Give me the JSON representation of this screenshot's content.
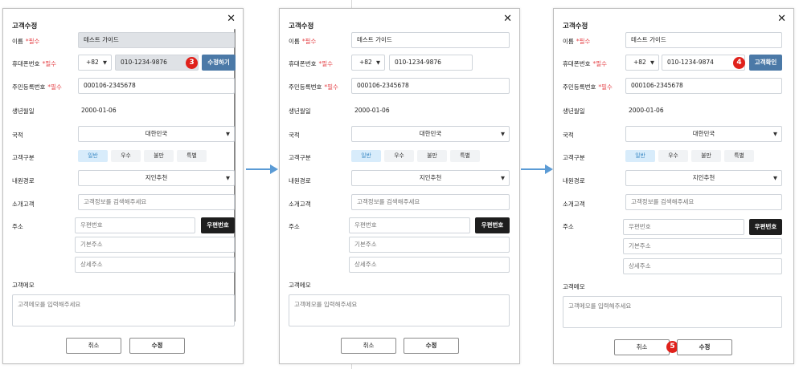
{
  "dialog": {
    "title": "고객수정",
    "close_glyph": "✕",
    "required_mark": "*필수",
    "labels": {
      "name": "이름",
      "phone": "휴대폰번호",
      "rrn": "주민등록번호",
      "birth": "생년월일",
      "nationality": "국적",
      "category": "고객구분",
      "visit_route": "내원경로",
      "referrer": "소개고객",
      "address": "주소",
      "memo": "고객메모"
    },
    "values": {
      "name": "테스트 가이드",
      "country_code": "+82",
      "rrn": "000106-2345678",
      "birth": "2000-01-06",
      "nationality": "대한민국",
      "visit_route": "지인추천"
    },
    "placeholders": {
      "referrer": "고객정보를 검색해주세요",
      "zipcode": "우편번호",
      "address1": "기본주소",
      "address2": "상세주소",
      "memo": "고객메모를 입력해주세요"
    },
    "category_options": [
      "일반",
      "우수",
      "불만",
      "특별"
    ],
    "selected_category": "일반",
    "buttons": {
      "zipcode": "우편번호",
      "cancel": "취소",
      "save": "수정",
      "edit_phone": "수정하기",
      "check_customer": "고객확인"
    }
  },
  "steps": [
    {
      "phone": "010-1234-9876",
      "badge": "3"
    },
    {
      "phone": "010-1234-9876"
    },
    {
      "phone": "010-1234-9874",
      "badge": "4",
      "save_badge": "5"
    }
  ],
  "colors": {
    "primary_button": "#4b79a7",
    "dark_button": "#1e1e1e",
    "required": "#e5484d",
    "badge": "#e0211b",
    "flow_arrow": "#5b9bd5",
    "selected_chip": "#d8ecfb"
  }
}
